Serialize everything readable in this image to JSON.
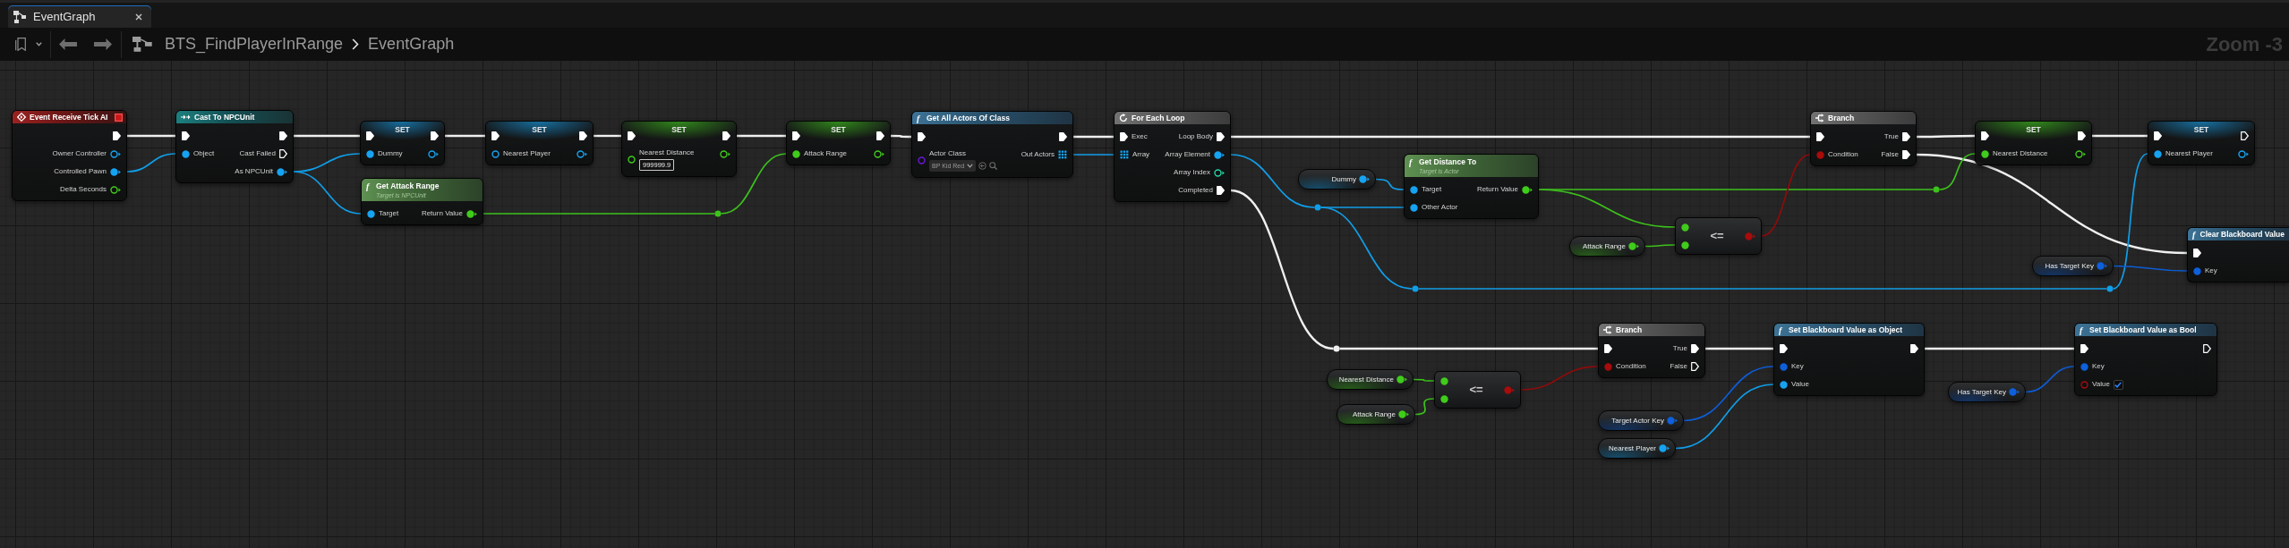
{
  "tab": {
    "title": "EventGraph",
    "selected": true
  },
  "toolbar": {
    "breadcrumb": [
      "BTS_FindPlayerInRange",
      "EventGraph"
    ],
    "zoom": "Zoom -3"
  },
  "graph": {
    "nodes": [
      {
        "kind": "event",
        "title": "Event Receive Tick AI",
        "outputs": [
          {
            "kind": "exec",
            "connected": true
          },
          {
            "kind": "object",
            "label": "Owner Controller",
            "connected": false
          },
          {
            "kind": "object",
            "label": "Controlled Pawn",
            "connected": true
          },
          {
            "kind": "float",
            "label": "Delta Seconds",
            "connected": false
          }
        ]
      },
      {
        "kind": "cast",
        "title": "Cast To NPCUnit",
        "inputs": [
          {
            "kind": "exec",
            "connected": true
          },
          {
            "kind": "object",
            "label": "Object",
            "connected": true
          }
        ],
        "outputs": [
          {
            "kind": "exec",
            "connected": true
          },
          {
            "kind": "exec",
            "label": "Cast Failed",
            "connected": false
          },
          {
            "kind": "object",
            "label": "As NPCUnit",
            "connected": true
          }
        ]
      },
      {
        "kind": "set",
        "title": "SET",
        "inputs": [
          {
            "kind": "exec",
            "connected": true
          },
          {
            "kind": "object",
            "label": "Dummy",
            "connected": true
          }
        ],
        "outputs": [
          {
            "kind": "exec",
            "connected": true
          },
          {
            "kind": "object",
            "connected": false
          }
        ]
      },
      {
        "kind": "pure-function",
        "glyph": "f",
        "title": "Get Attack Range",
        "subtitle": "Target is NPCUnit",
        "inputs": [
          {
            "kind": "object",
            "label": "Target",
            "connected": true
          }
        ],
        "outputs": [
          {
            "kind": "float",
            "label": "Return Value",
            "connected": true
          }
        ]
      },
      {
        "kind": "set",
        "title": "SET",
        "inputs": [
          {
            "kind": "exec",
            "connected": true
          },
          {
            "kind": "object",
            "label": "Nearest Player",
            "connected": false
          }
        ],
        "outputs": [
          {
            "kind": "exec",
            "connected": true
          },
          {
            "kind": "object",
            "connected": false
          }
        ]
      },
      {
        "kind": "set",
        "title": "SET",
        "inputs": [
          {
            "kind": "exec",
            "connected": true
          },
          {
            "kind": "float",
            "label": "Nearest Distance",
            "connected": false,
            "value": "999999.9"
          }
        ],
        "outputs": [
          {
            "kind": "exec",
            "connected": true
          },
          {
            "kind": "float",
            "connected": false
          }
        ]
      },
      {
        "kind": "set",
        "title": "SET",
        "inputs": [
          {
            "kind": "exec",
            "connected": true
          },
          {
            "kind": "float",
            "label": "Attack Range",
            "connected": true
          }
        ],
        "outputs": [
          {
            "kind": "exec",
            "connected": true
          },
          {
            "kind": "float",
            "connected": false
          }
        ]
      },
      {
        "kind": "function",
        "glyph": "f",
        "title": "Get All Actors Of Class",
        "inputs": [
          {
            "kind": "exec",
            "connected": true
          },
          {
            "kind": "class",
            "label": "Actor Class",
            "connected": false,
            "value": "BP Kid Red"
          }
        ],
        "outputs": [
          {
            "kind": "exec",
            "connected": true
          },
          {
            "kind": "array",
            "label": "Out Actors",
            "connected": true
          }
        ]
      },
      {
        "kind": "loop",
        "title": "For Each Loop",
        "inputs": [
          {
            "kind": "exec",
            "label": "Exec",
            "connected": true
          },
          {
            "kind": "array",
            "label": "Array",
            "connected": true
          }
        ],
        "outputs": [
          {
            "kind": "exec",
            "label": "Loop Body",
            "connected": true
          },
          {
            "kind": "object",
            "label": "Array Element",
            "connected": true
          },
          {
            "kind": "int",
            "label": "Array Index",
            "connected": false
          },
          {
            "kind": "exec",
            "label": "Completed",
            "connected": true
          }
        ]
      },
      {
        "kind": "getter",
        "outputs": [
          {
            "kind": "object",
            "label": "Dummy",
            "connected": true
          }
        ]
      },
      {
        "kind": "pure-function",
        "glyph": "f",
        "title": "Get Distance To",
        "subtitle": "Target is Actor",
        "inputs": [
          {
            "kind": "object",
            "label": "Target",
            "connected": true
          },
          {
            "kind": "object",
            "label": "Other Actor",
            "connected": true
          }
        ],
        "outputs": [
          {
            "kind": "float",
            "label": "Return Value",
            "connected": true
          }
        ]
      },
      {
        "kind": "getter",
        "outputs": [
          {
            "kind": "float",
            "label": "Attack Range",
            "connected": true
          }
        ]
      },
      {
        "kind": "operator",
        "title": "<=",
        "inputs": [
          {
            "kind": "float",
            "connected": true
          },
          {
            "kind": "float",
            "connected": true
          }
        ],
        "outputs": [
          {
            "kind": "bool",
            "connected": true
          }
        ]
      },
      {
        "kind": "branch",
        "title": "Branch",
        "inputs": [
          {
            "kind": "exec",
            "connected": true
          },
          {
            "kind": "bool",
            "label": "Condition",
            "connected": true
          }
        ],
        "outputs": [
          {
            "kind": "exec",
            "label": "True",
            "connected": true
          },
          {
            "kind": "exec",
            "label": "False",
            "connected": true
          }
        ]
      },
      {
        "kind": "set",
        "title": "SET",
        "inputs": [
          {
            "kind": "exec",
            "connected": true
          },
          {
            "kind": "float",
            "label": "Nearest Distance",
            "connected": true
          }
        ],
        "outputs": [
          {
            "kind": "exec",
            "connected": true
          },
          {
            "kind": "float",
            "connected": false
          }
        ]
      },
      {
        "kind": "set",
        "title": "SET",
        "inputs": [
          {
            "kind": "exec",
            "connected": true
          },
          {
            "kind": "object",
            "label": "Nearest Player",
            "connected": true
          }
        ],
        "outputs": [
          {
            "kind": "exec",
            "connected": false
          },
          {
            "kind": "object",
            "connected": false
          }
        ]
      },
      {
        "kind": "getter",
        "outputs": [
          {
            "kind": "key",
            "label": "Has Target Key",
            "connected": true
          }
        ]
      },
      {
        "kind": "function",
        "glyph": "f",
        "title": "Clear Blackboard Value",
        "inputs": [
          {
            "kind": "exec",
            "connected": true
          },
          {
            "kind": "key",
            "label": "Key",
            "connected": true
          }
        ]
      },
      {
        "kind": "branch",
        "title": "Branch",
        "inputs": [
          {
            "kind": "exec",
            "connected": true
          },
          {
            "kind": "bool",
            "label": "Condition",
            "connected": true
          }
        ],
        "outputs": [
          {
            "kind": "exec",
            "label": "True",
            "connected": true
          },
          {
            "kind": "exec",
            "label": "False",
            "connected": false
          }
        ]
      },
      {
        "kind": "getter",
        "outputs": [
          {
            "kind": "float",
            "label": "Nearest Distance",
            "connected": true
          }
        ]
      },
      {
        "kind": "getter",
        "outputs": [
          {
            "kind": "float",
            "label": "Attack Range",
            "connected": true
          }
        ]
      },
      {
        "kind": "operator",
        "title": "<=",
        "inputs": [
          {
            "kind": "float",
            "connected": true
          },
          {
            "kind": "float",
            "connected": true
          }
        ],
        "outputs": [
          {
            "kind": "bool",
            "connected": true
          }
        ]
      },
      {
        "kind": "function",
        "glyph": "f",
        "title": "Set Blackboard Value as Object",
        "inputs": [
          {
            "kind": "exec",
            "connected": true
          },
          {
            "kind": "key",
            "label": "Key",
            "connected": true
          },
          {
            "kind": "object",
            "label": "Value",
            "connected": true
          }
        ],
        "outputs": [
          {
            "kind": "exec",
            "connected": true
          }
        ]
      },
      {
        "kind": "getter",
        "outputs": [
          {
            "kind": "key",
            "label": "Target Actor Key",
            "connected": true
          }
        ]
      },
      {
        "kind": "getter",
        "outputs": [
          {
            "kind": "object",
            "label": "Nearest Player",
            "connected": true
          }
        ]
      },
      {
        "kind": "getter",
        "outputs": [
          {
            "kind": "key",
            "label": "Has Target Key",
            "connected": true
          }
        ]
      },
      {
        "kind": "function",
        "glyph": "f",
        "title": "Set Blackboard Value as Bool",
        "inputs": [
          {
            "kind": "exec",
            "connected": true
          },
          {
            "kind": "key",
            "label": "Key",
            "connected": true
          },
          {
            "kind": "bool",
            "label": "Value",
            "connected": false,
            "checked": true
          }
        ],
        "outputs": [
          {
            "kind": "exec",
            "connected": false
          }
        ]
      }
    ]
  }
}
